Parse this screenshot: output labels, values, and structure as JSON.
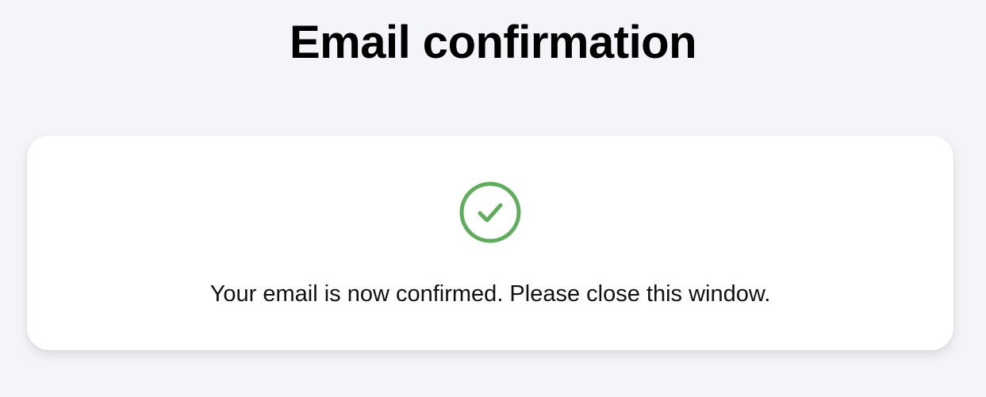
{
  "page": {
    "title": "Email confirmation"
  },
  "card": {
    "icon": "check-circle-icon",
    "message": "Your email is now confirmed. Please close this window."
  },
  "colors": {
    "background": "#f4f5f9",
    "card": "#ffffff",
    "success": "#5fad5c",
    "text": "#111111"
  }
}
